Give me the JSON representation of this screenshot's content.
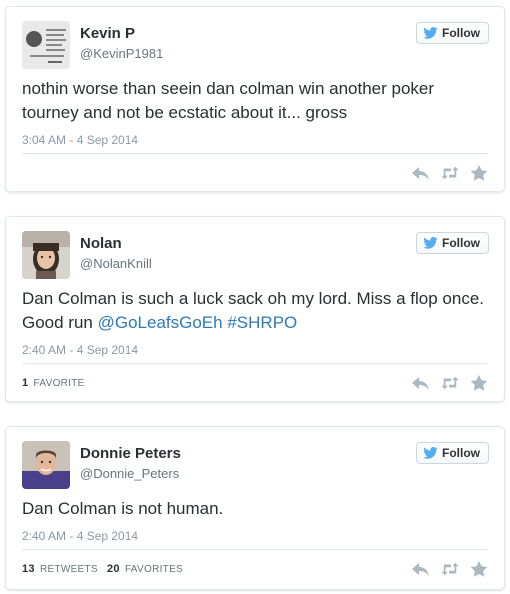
{
  "colors": {
    "text": "#292f33",
    "muted": "#8899a6",
    "link": "#2b7bb9",
    "bird": "#55acee",
    "action_icon": "#aab8c2"
  },
  "tweets": [
    {
      "name": "Kevin P",
      "handle": "@KevinP1981",
      "follow_label": "Follow",
      "text": "nothin worse than seein dan colman win another poker tourney and not be ecstatic about it... gross",
      "date": "3:04 AM - 4 Sep 2014",
      "icons": [
        "reply-icon",
        "retweet-icon",
        "favorite-icon"
      ]
    },
    {
      "name": "Nolan",
      "handle": "@NolanKnill",
      "follow_label": "Follow",
      "text_plain": "Dan Colman is such a luck sack oh my lord. Miss a flop once. Good run ",
      "mention": "@GoLeafsGoEh",
      "hashtag": "#SHRPO",
      "date": "2:40 AM - 4 Sep 2014",
      "favorites_count": "1",
      "favorites_label": "FAVORITE",
      "icons": [
        "reply-icon",
        "retweet-icon",
        "favorite-icon"
      ]
    },
    {
      "name": "Donnie Peters",
      "handle": "@Donnie_Peters",
      "follow_label": "Follow",
      "text": "Dan Colman is not human.",
      "date": "2:40 AM - 4 Sep 2014",
      "retweets_count": "13",
      "retweets_label": "RETWEETS",
      "favorites_count": "20",
      "favorites_label": "FAVORITES",
      "icons": [
        "reply-icon",
        "retweet-icon",
        "favorite-icon"
      ]
    }
  ]
}
